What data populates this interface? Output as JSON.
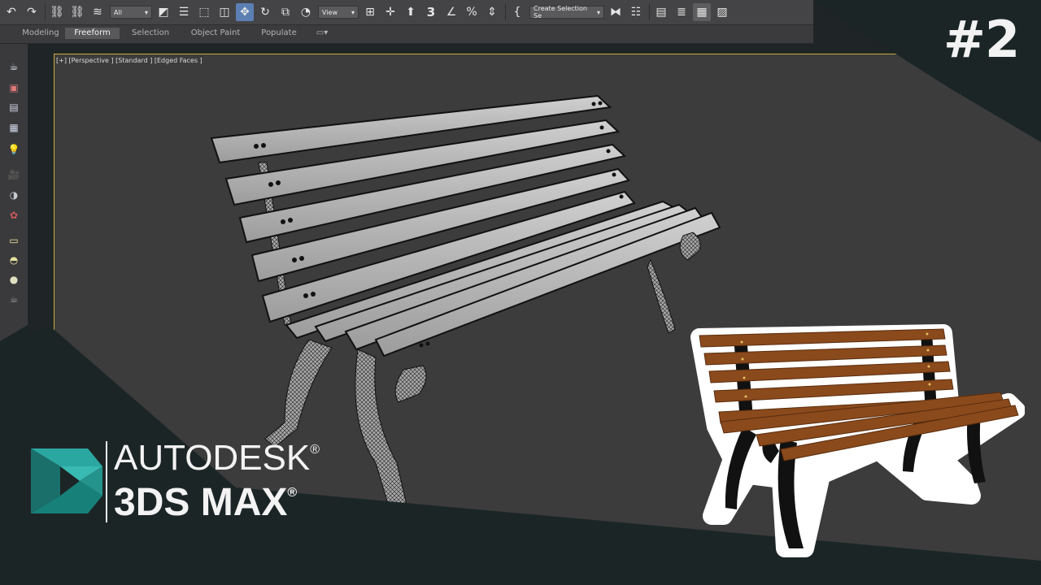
{
  "toolbar": {
    "selection_filter": "All",
    "coordinate_system": "View",
    "snap_angle": "3",
    "named_selection_placeholder": "Create Selection Se",
    "icons": [
      "undo-icon",
      "redo-icon",
      "link-icon",
      "unlink-icon",
      "bind-space-warp-icon",
      "select-object-icon",
      "select-by-name-icon",
      "rectangular-selection-icon",
      "window-crossing-icon",
      "select-move-icon",
      "select-rotate-icon",
      "select-scale-icon",
      "use-pivot-center-icon",
      "select-manipulate-icon",
      "keyboard-shortcut-override-icon",
      "snaps-toggle-icon",
      "angle-snap-icon",
      "percent-snap-icon",
      "spinner-snap-icon",
      "edit-named-selection-icon",
      "mirror-icon",
      "align-icon",
      "scene-explorer-icon",
      "layer-explorer-icon",
      "ribbon-toggle-icon",
      "curve-editor-icon"
    ]
  },
  "ribbon": {
    "tabs": [
      "Modeling",
      "Freeform",
      "Selection",
      "Object Paint",
      "Populate"
    ],
    "active_tab": "Freeform"
  },
  "viewport": {
    "label": "[+] [Perspective ] [Standard ] [Edged Faces ]"
  },
  "overlay": {
    "episode": "#2",
    "brand_line1": "AUTODESK",
    "brand_line2": "3DS MAX",
    "registered_mark": "®"
  },
  "colors": {
    "accent_blue": "#5b7fb4",
    "viewport_border": "#c8aa3c",
    "logo_teal": "#1e8f8a",
    "bench_wood": "#8a4a1c"
  }
}
